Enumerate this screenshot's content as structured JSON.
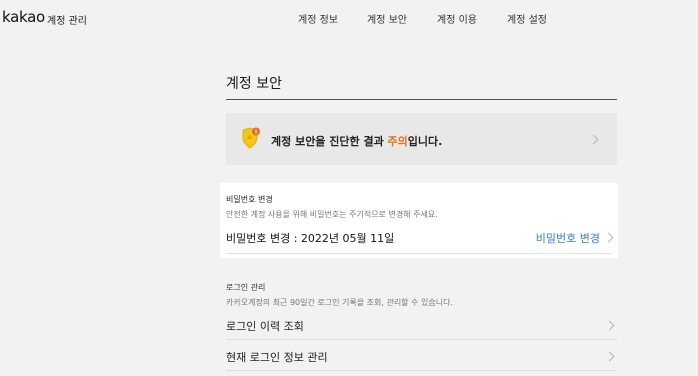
{
  "header": {
    "logo": "kakao",
    "logo_sub": "계정 관리",
    "nav": [
      "계정 정보",
      "계정 보안",
      "계정 이용",
      "계정 설정"
    ]
  },
  "page": {
    "title": "계정 보안"
  },
  "diagnosis": {
    "text_before": "계정 보안을 진단한 결과 ",
    "status": "주의",
    "text_after": "입니다.",
    "badge": "!",
    "status_color": "#ec6a18"
  },
  "password": {
    "title": "비밀번호 변경",
    "description": "안전한 계정 사용을 위해 비밀번호는 주기적으로 변경해 주세요.",
    "date_text": "비밀번호 변경 : 2022년 05월 11일",
    "change_link": "비밀번호 변경",
    "link_color": "#3b7bd4"
  },
  "login": {
    "title": "로그인 관리",
    "description": "카카오계정의 최근 90일간 로그인 기록을 조회, 관리할 수 있습니다.",
    "rows": [
      "로그인 이력 조회",
      "현재 로그인 정보 관리"
    ]
  }
}
